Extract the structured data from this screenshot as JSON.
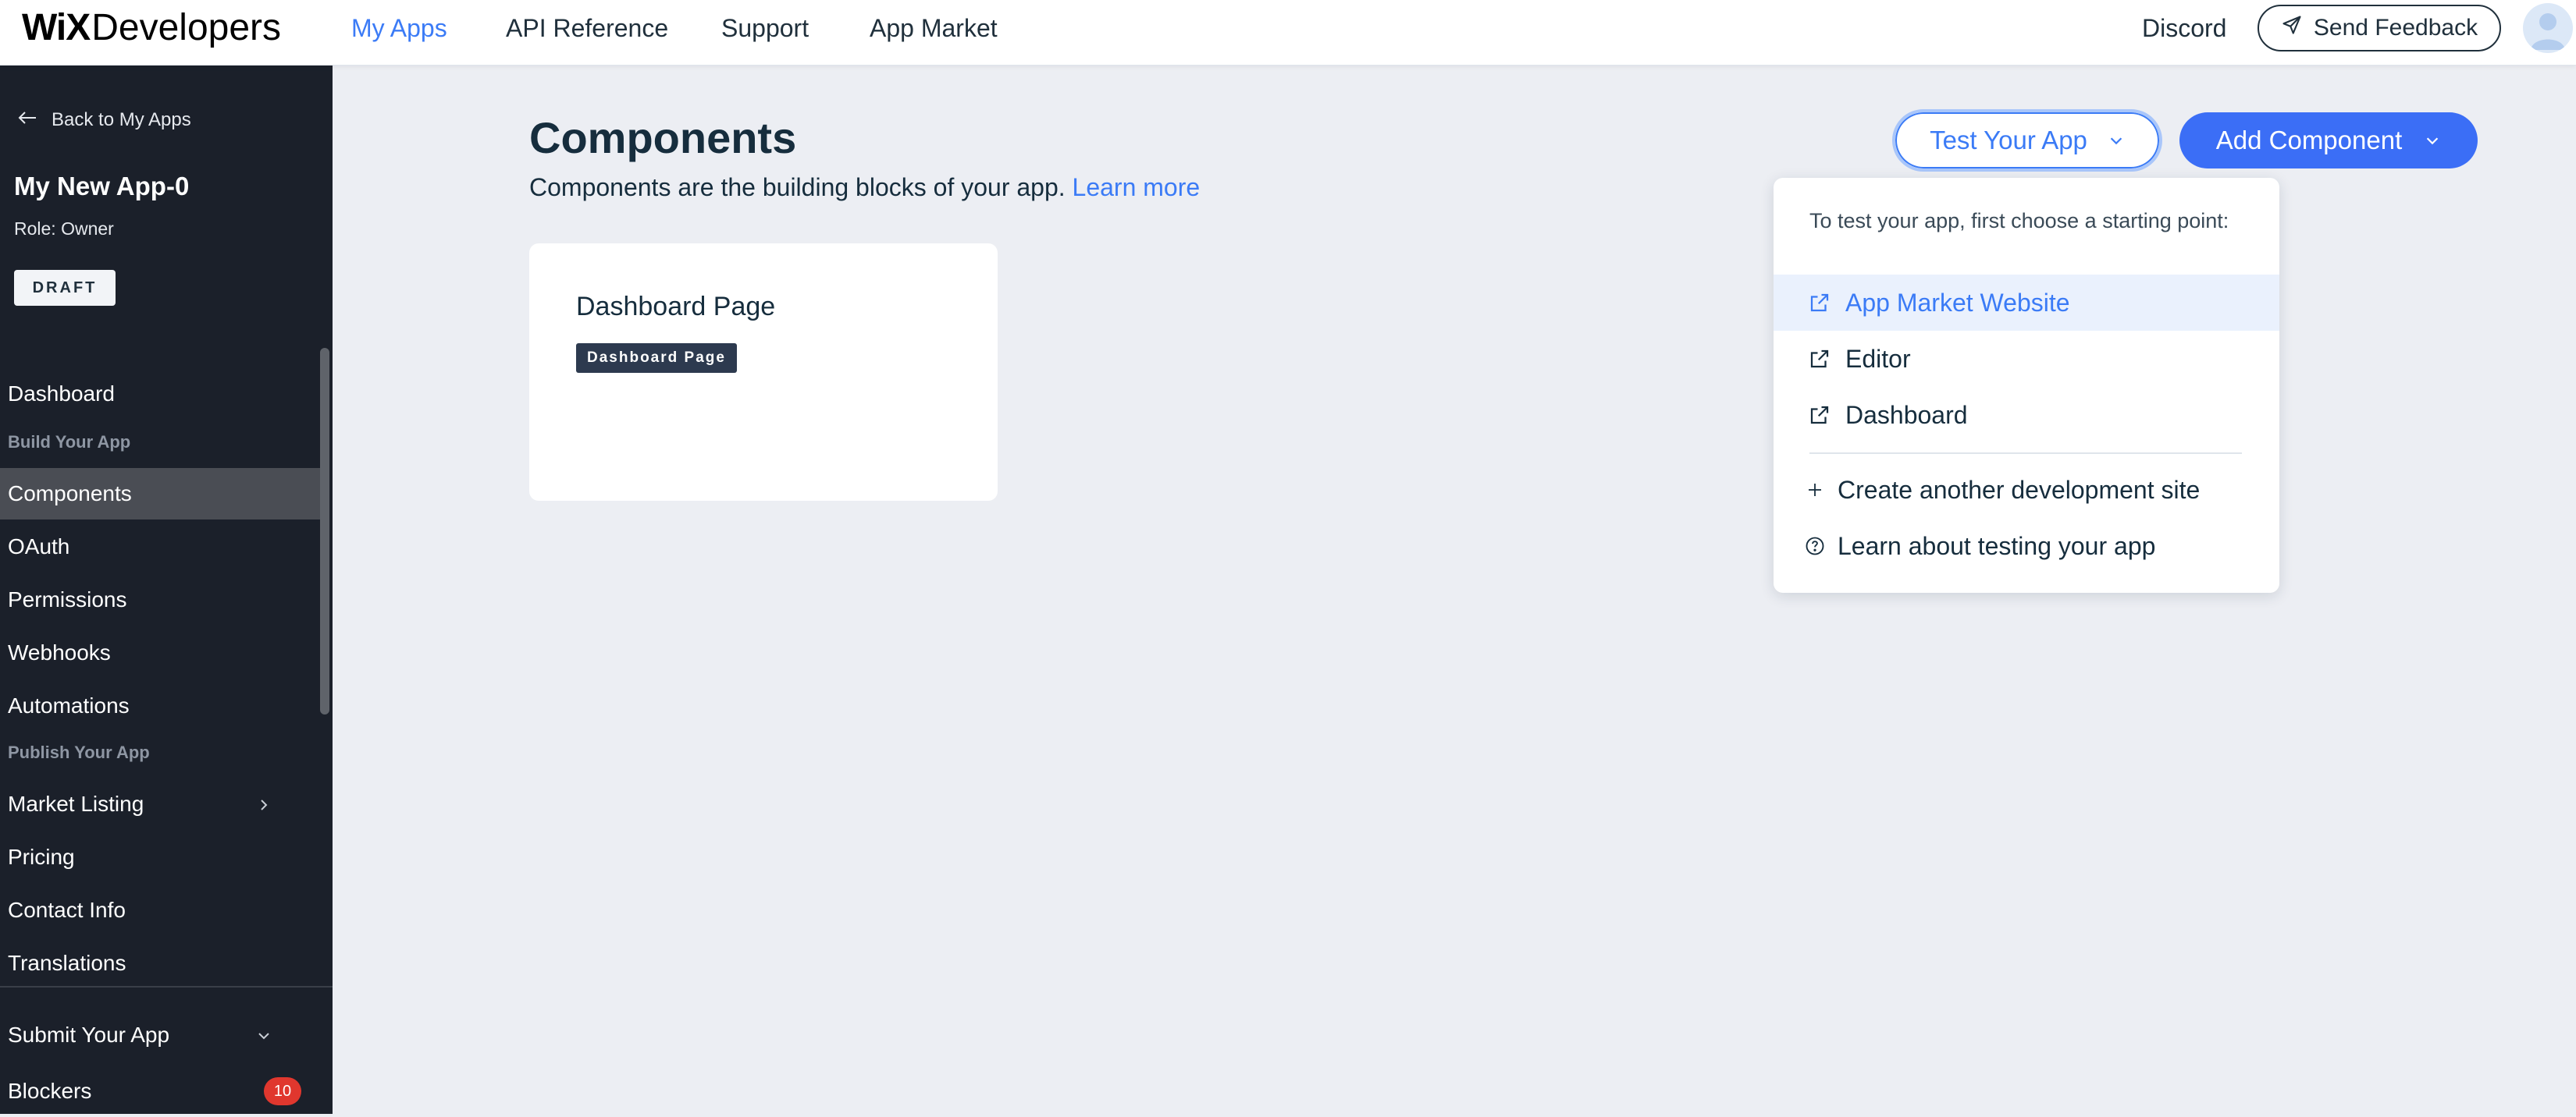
{
  "header": {
    "logo_brand": "WiX",
    "logo_product": "Developers",
    "nav": [
      {
        "label": "My Apps",
        "active": true
      },
      {
        "label": "API Reference",
        "active": false
      },
      {
        "label": "Support",
        "active": false
      },
      {
        "label": "App Market",
        "active": false
      }
    ],
    "discord_label": "Discord",
    "feedback_label": "Send Feedback"
  },
  "sidebar": {
    "back_label": "Back to My Apps",
    "app_name": "My New App-0",
    "role": "Role: Owner",
    "status_badge": "DRAFT",
    "items": {
      "dashboard": "Dashboard",
      "section_build": "Build Your App",
      "components": "Components",
      "oauth": "OAuth",
      "permissions": "Permissions",
      "webhooks": "Webhooks",
      "automations": "Automations",
      "section_publish": "Publish Your App",
      "market_listing": "Market Listing",
      "pricing": "Pricing",
      "contact_info": "Contact Info",
      "translations": "Translations",
      "submit": "Submit Your App",
      "blockers": "Blockers",
      "blockers_count": "10"
    },
    "active_item": "Components"
  },
  "main": {
    "title": "Components",
    "description": "Components are the building blocks of your app.",
    "learn_more": "Learn more",
    "test_button": "Test Your App",
    "add_button": "Add Component",
    "cards": [
      {
        "title": "Dashboard Page",
        "tag": "Dashboard Page"
      }
    ]
  },
  "dropdown": {
    "intro": "To test your app, first choose a starting point:",
    "items": [
      {
        "label": "App Market Website",
        "icon": "external-link-icon",
        "highlighted": true
      },
      {
        "label": "Editor",
        "icon": "external-link-icon",
        "highlighted": false
      },
      {
        "label": "Dashboard",
        "icon": "external-link-icon",
        "highlighted": false
      },
      {
        "label": "Create another development site",
        "icon": "plus-icon",
        "highlighted": false
      },
      {
        "label": "Learn about testing your app",
        "icon": "question-circle-icon",
        "highlighted": false
      }
    ]
  },
  "colors": {
    "accent": "#3b7bf6",
    "primary_button": "#3b6ef6",
    "sidebar_bg": "#1b202a",
    "page_bg": "#eceef3",
    "badge_red": "#e0372e"
  }
}
